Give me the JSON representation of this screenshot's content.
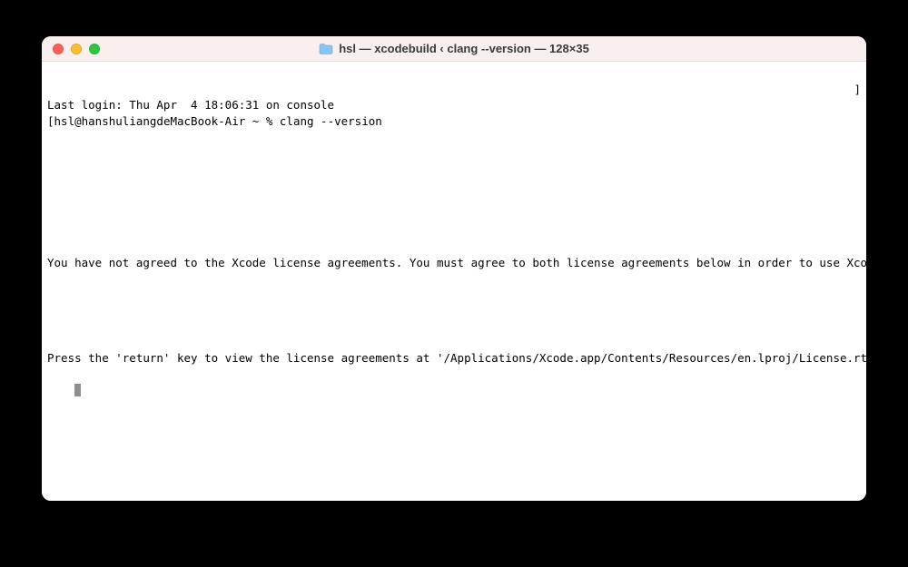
{
  "window": {
    "title": "hsl — xcodebuild ‹ clang --version — 128×35"
  },
  "terminal": {
    "last_login": "Last login: Thu Apr  4 18:06:31 on console",
    "prompt_prefix": "[",
    "prompt": "hsl@hanshuliangdeMacBook-Air ~ % ",
    "command": "clang --version",
    "bracket_right": "]",
    "output_line1": "You have not agreed to the Xcode license agreements. You must agree to both license agreements below in order to use Xcode.",
    "output_line2": "Press the 'return' key to view the license agreements at '/Applications/Xcode.app/Contents/Resources/en.lproj/License.rtf'"
  }
}
